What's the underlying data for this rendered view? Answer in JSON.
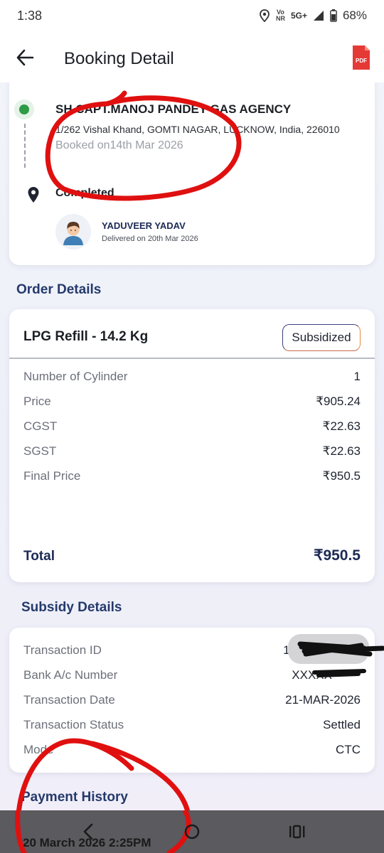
{
  "status_bar": {
    "time": "1:38",
    "network_top": "Vo",
    "network_bottom": "NR",
    "network_type": "5G+",
    "battery": "68%",
    "icons": [
      "location-icon",
      "signal-icon",
      "battery-icon"
    ]
  },
  "app_bar": {
    "title": "Booking Detail",
    "back_icon": "arrow-left-icon",
    "pdf_label": "PDF"
  },
  "booking": {
    "agency_name": "SH.CAPT.MANOJ PANDEY GAS AGENCY",
    "address": "1/262 Vishal Khand, GOMTI NAGAR, LUCKNOW, India, 226010",
    "booked_on": "Booked on14th Mar 2026",
    "status": "Completed",
    "delivery_person": "YADUVEER YADAV",
    "delivered_on": "Delivered on 20th Mar 2026"
  },
  "order_details": {
    "section_title": "Order Details",
    "product": "LPG Refill - 14.2 Kg",
    "badge": "Subsidized",
    "rows": [
      {
        "label": "Number of Cylinder",
        "value": "1"
      },
      {
        "label": "Price",
        "value": "₹905.24"
      },
      {
        "label": "CGST",
        "value": "₹22.63"
      },
      {
        "label": "SGST",
        "value": "₹22.63"
      },
      {
        "label": "Final Price",
        "value": "₹950.5"
      }
    ],
    "total_label": "Total",
    "total_value": "₹950.5"
  },
  "subsidy_details": {
    "section_title": "Subsidy Details",
    "rows": [
      {
        "label": "Transaction ID",
        "value": "10"
      },
      {
        "label": "Bank A/c Number",
        "value": "XXXXX"
      },
      {
        "label": "Transaction Date",
        "value": "21-MAR-2026"
      },
      {
        "label": "Transaction Status",
        "value": "Settled"
      },
      {
        "label": "Mode",
        "value": "CTC"
      }
    ]
  },
  "payment_history": {
    "section_title": "Payment History",
    "first_entry": "20 March 2026 2:25PM"
  },
  "colors": {
    "accent_navy": "#243a6b",
    "success_green": "#2e9b45",
    "pdf_red": "#e53935",
    "annotation_red": "#e01010"
  }
}
